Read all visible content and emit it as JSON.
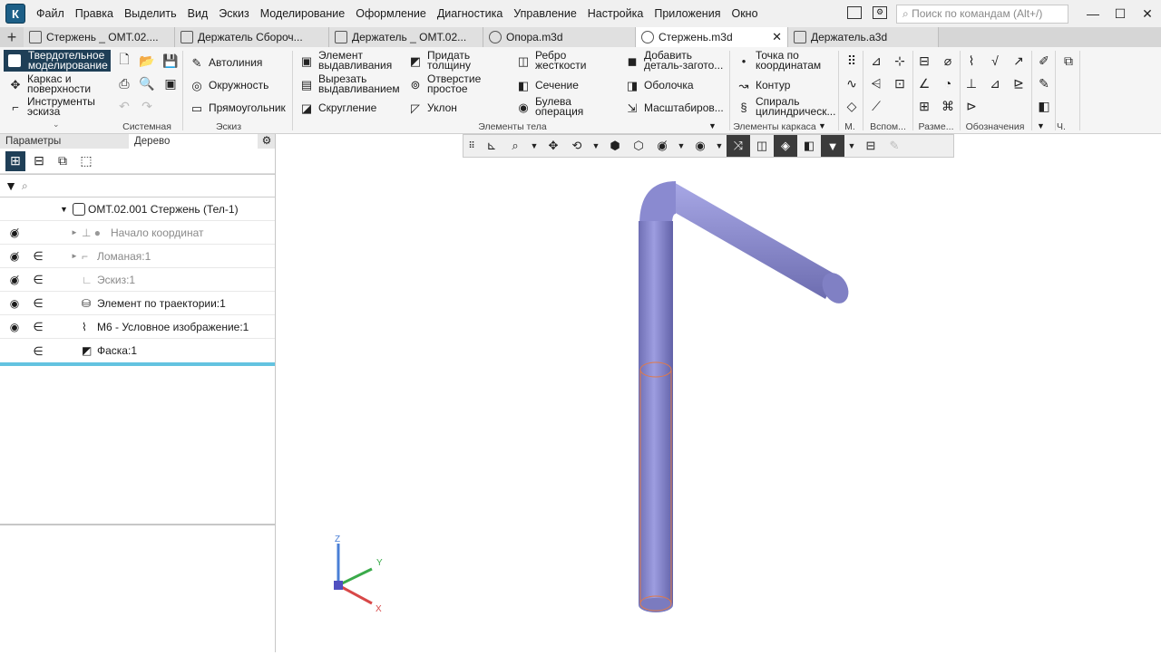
{
  "menu": [
    "Файл",
    "Правка",
    "Выделить",
    "Вид",
    "Эскиз",
    "Моделирование",
    "Оформление",
    "Диагностика",
    "Управление",
    "Настройка",
    "Приложения",
    "Окно"
  ],
  "search_placeholder": "Поиск по командам (Alt+/)",
  "tabs": [
    {
      "label": "Стержень _ ОМТ.02....",
      "active": false,
      "closable": false
    },
    {
      "label": "Держатель Сбороч...",
      "active": false,
      "closable": false
    },
    {
      "label": "Держатель _ ОМТ.02...",
      "active": false,
      "closable": false
    },
    {
      "label": "Опора.m3d",
      "active": false,
      "closable": false
    },
    {
      "label": "Стержень.m3d",
      "active": true,
      "closable": true
    },
    {
      "label": "Держатель.a3d",
      "active": false,
      "closable": false
    }
  ],
  "ribbon": {
    "modes": [
      "Твердотельное моделирование",
      "Каркас и поверхности",
      "Инструменты эскиза"
    ],
    "sketch_items": [
      "Автолиния",
      "Окружность",
      "Прямоугольник"
    ],
    "body_items": [
      {
        "label": "Элемент выдавливания"
      },
      {
        "label": "Вырезать выдавливанием"
      },
      {
        "label": "Скругление"
      },
      {
        "label": "Придать толщину"
      },
      {
        "label": "Отверстие простое"
      },
      {
        "label": "Уклон"
      },
      {
        "label": "Ребро жесткости"
      },
      {
        "label": "Сечение"
      },
      {
        "label": "Булева операция"
      },
      {
        "label": "Добавить деталь-загото..."
      },
      {
        "label": "Оболочка"
      },
      {
        "label": "Масштабиров..."
      }
    ],
    "frame_items": [
      "Точка по координатам",
      "Контур",
      "Спираль цилиндрическ..."
    ],
    "groups": [
      "Системная",
      "Эскиз",
      "Элементы тела",
      "Элементы каркаса",
      "М.",
      "Вспом...",
      "Разме...",
      "Обозначения",
      "Ч."
    ]
  },
  "panel": {
    "tabs": [
      "Параметры",
      "Дерево"
    ],
    "active_tab": "Дерево",
    "root": "ОМТ.02.001 Стержень (Тел-1)",
    "items": [
      {
        "label": "Начало координат",
        "dim": true
      },
      {
        "label": "Ломаная:1",
        "dim": true
      },
      {
        "label": "Эскиз:1",
        "dim": true
      },
      {
        "label": "Элемент по траектории:1",
        "dim": false
      },
      {
        "label": "М6 - Условное изображение:1",
        "dim": false
      },
      {
        "label": "Фаска:1",
        "dim": false
      }
    ]
  },
  "axes": {
    "x": "X",
    "y": "Y",
    "z": "Z"
  },
  "colors": {
    "accent": "#1f3f57",
    "model": "#8686c8",
    "thread": "#e07a4a",
    "selection": "#63c3e0"
  }
}
